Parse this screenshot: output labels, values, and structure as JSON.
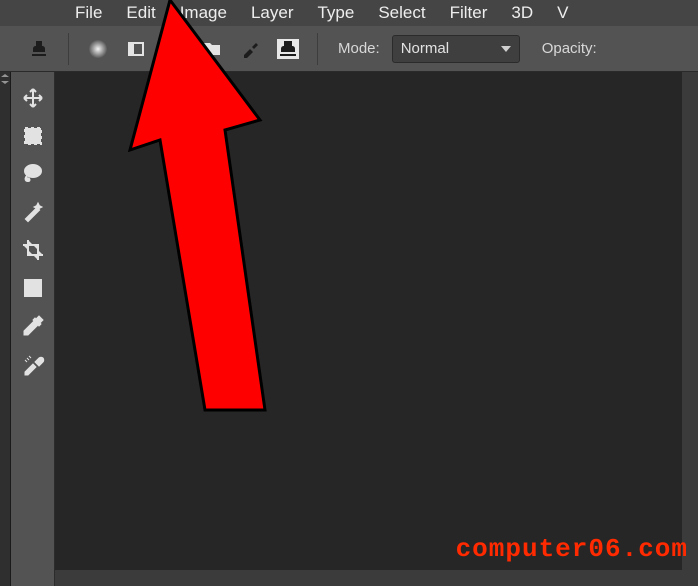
{
  "menubar": {
    "items": [
      "File",
      "Edit",
      "Image",
      "Layer",
      "Type",
      "Select",
      "Filter",
      "3D",
      "V"
    ]
  },
  "optionsbar": {
    "mode_label": "Mode:",
    "mode_value": "Normal",
    "opacity_label": "Opacity:",
    "icons": [
      "stamp-icon",
      "brush-preset-icon",
      "toggle-panel-icon",
      "brush-settings-icon",
      "folder-icon",
      "art-brush-icon",
      "pattern-stamp-icon"
    ]
  },
  "toolbar": {
    "tools": [
      {
        "name": "move-tool-icon"
      },
      {
        "name": "rectangular-marquee-tool-icon"
      },
      {
        "name": "lasso-tool-icon"
      },
      {
        "name": "magic-wand-tool-icon"
      },
      {
        "name": "crop-tool-icon"
      },
      {
        "name": "frame-tool-icon"
      },
      {
        "name": "eyedropper-tool-icon"
      },
      {
        "name": "healing-brush-tool-icon"
      }
    ]
  },
  "watermark": "computer06.com"
}
